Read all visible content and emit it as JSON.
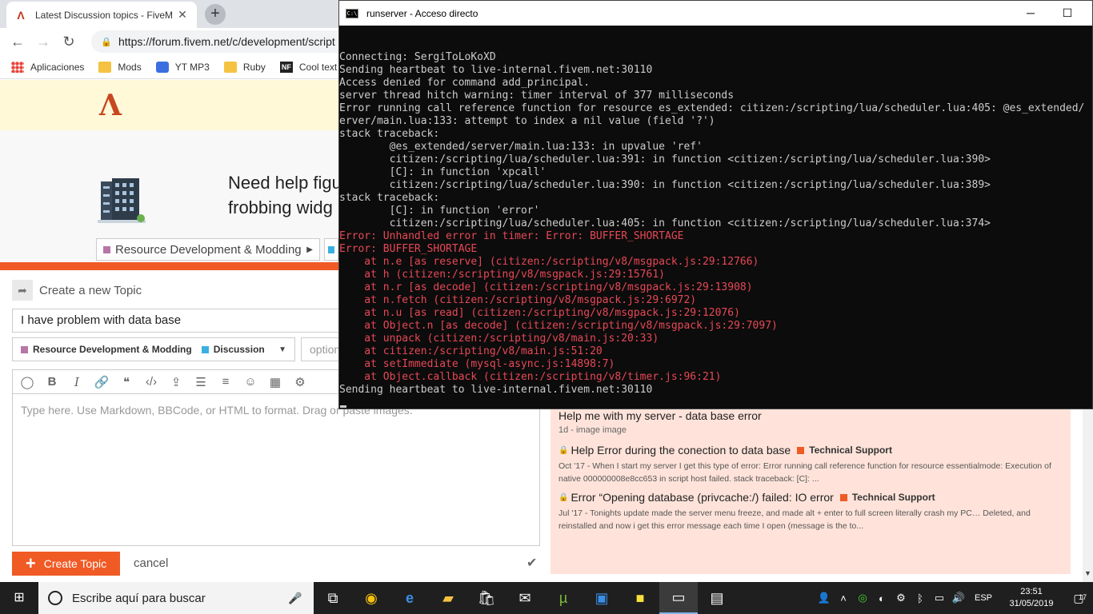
{
  "browser": {
    "tab_title": "Latest Discussion topics - FiveM",
    "url": "https://forum.fivem.net/c/development/script",
    "bookmarks": [
      {
        "label": "Aplicaciones",
        "icon": "apps-icon"
      },
      {
        "label": "Mods",
        "icon": "folder-icon"
      },
      {
        "label": "YT MP3",
        "icon": "youtube-icon"
      },
      {
        "label": "Ruby",
        "icon": "folder-icon"
      },
      {
        "label": "Cool text ge",
        "icon": "nf-icon"
      }
    ]
  },
  "forum": {
    "banner_line1": "Need help figu",
    "banner_line2": "frobbing widg",
    "breadcrumb_category": "Resource Development & Modding",
    "composer": {
      "header": "Create a new Topic",
      "title_value": "I have problem with data base",
      "category": "Resource Development & Modding",
      "subcategory": "Discussion",
      "tags_placeholder": "optional tags",
      "editor_placeholder": "Type here. Use Markdown, BBCode, or HTML to format. Drag or paste images.",
      "create_label": "Create Topic",
      "cancel_label": "cancel"
    },
    "similar": {
      "first_title": "Help me with my server - data base error",
      "first_meta": "1d - image image",
      "items": [
        {
          "title": "Help Error during the conection to data base",
          "category": "Technical Support",
          "excerpt": "Oct '17 - When I start my server I get this type of error: Error running call reference function for resource essentialmode: Execution of native 000000008e8cc653 in script host failed. stack traceback: [C]: ..."
        },
        {
          "title": "Error “Opening database (privcache:/) failed: IO error",
          "category": "Technical Support",
          "excerpt": "Jul '17 - Tonights update made the server menu freeze, and made alt + enter to full screen literally crash my PC… Deleted, and reinstalled and now i get this error message each time I open (message is the to..."
        }
      ]
    },
    "colors": {
      "accent": "#f05a24",
      "category_resource": "#b776a6",
      "category_discussion": "#3ab0e2",
      "header_bg": "#fff9d8",
      "similar_bg": "#ffe3da"
    }
  },
  "console": {
    "title": "runserver - Acceso directo",
    "lines": [
      {
        "text": "Connecting: SergiToLoKoXD",
        "err": false
      },
      {
        "text": "Sending heartbeat to live-internal.fivem.net:30110",
        "err": false
      },
      {
        "text": "Access denied for command add_principal.",
        "err": false
      },
      {
        "text": "server thread hitch warning: timer interval of 377 milliseconds",
        "err": false
      },
      {
        "text": "Error running call reference function for resource es_extended: citizen:/scripting/lua/scheduler.lua:405: @es_extended/",
        "err": false
      },
      {
        "text": "erver/main.lua:133: attempt to index a nil value (field '?')",
        "err": false
      },
      {
        "text": "stack traceback:",
        "err": false
      },
      {
        "text": "        @es_extended/server/main.lua:133: in upvalue 'ref'",
        "err": false
      },
      {
        "text": "        citizen:/scripting/lua/scheduler.lua:391: in function <citizen:/scripting/lua/scheduler.lua:390>",
        "err": false
      },
      {
        "text": "        [C]: in function 'xpcall'",
        "err": false
      },
      {
        "text": "        citizen:/scripting/lua/scheduler.lua:390: in function <citizen:/scripting/lua/scheduler.lua:389>",
        "err": false
      },
      {
        "text": "stack traceback:",
        "err": false
      },
      {
        "text": "        [C]: in function 'error'",
        "err": false
      },
      {
        "text": "        citizen:/scripting/lua/scheduler.lua:405: in function <citizen:/scripting/lua/scheduler.lua:374>",
        "err": false
      },
      {
        "text": "Error: Unhandled error in timer: Error: BUFFER_SHORTAGE",
        "err": true
      },
      {
        "text": "Error: BUFFER_SHORTAGE",
        "err": true
      },
      {
        "text": "    at n.e [as reserve] (citizen:/scripting/v8/msgpack.js:29:12766)",
        "err": true
      },
      {
        "text": "    at h (citizen:/scripting/v8/msgpack.js:29:15761)",
        "err": true
      },
      {
        "text": "    at n.r [as decode] (citizen:/scripting/v8/msgpack.js:29:13908)",
        "err": true
      },
      {
        "text": "    at n.fetch (citizen:/scripting/v8/msgpack.js:29:6972)",
        "err": true
      },
      {
        "text": "    at n.u [as read] (citizen:/scripting/v8/msgpack.js:29:12076)",
        "err": true
      },
      {
        "text": "    at Object.n [as decode] (citizen:/scripting/v8/msgpack.js:29:7097)",
        "err": true
      },
      {
        "text": "    at unpack (citizen:/scripting/v8/main.js:20:33)",
        "err": true
      },
      {
        "text": "    at citizen:/scripting/v8/main.js:51:20",
        "err": true
      },
      {
        "text": "    at setImmediate (mysql-async.js:14898:7)",
        "err": true
      },
      {
        "text": "    at Object.callback (citizen:/scripting/v8/timer.js:96:21)",
        "err": true
      },
      {
        "text": "Sending heartbeat to live-internal.fivem.net:30110",
        "err": false
      }
    ]
  },
  "taskbar": {
    "search_placeholder": "Escribe aquí para buscar",
    "language": "ESP",
    "time": "23:51",
    "date": "31/05/2019",
    "notification_count": "17"
  }
}
